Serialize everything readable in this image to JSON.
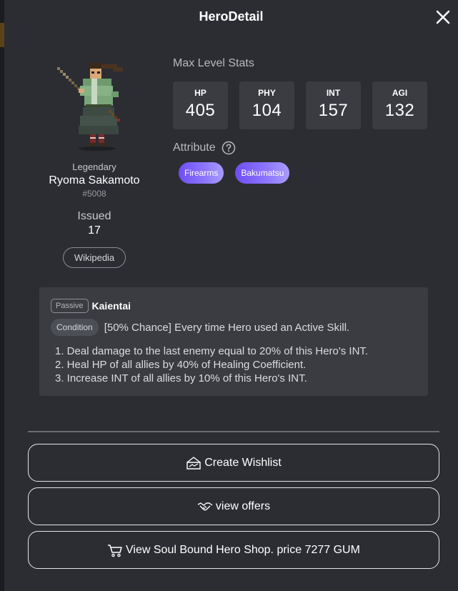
{
  "window": {
    "title": "HeroDetail",
    "close_icon": "close-icon"
  },
  "hero": {
    "rarity": "Legendary",
    "name": "Ryoma Sakamoto",
    "id": "#5008",
    "issued_label": "Issued",
    "issued_value": "17",
    "wiki_label": "Wikipedia"
  },
  "stats": {
    "heading": "Max Level Stats",
    "items": [
      {
        "name": "HP",
        "value": "405"
      },
      {
        "name": "PHY",
        "value": "104"
      },
      {
        "name": "INT",
        "value": "157"
      },
      {
        "name": "AGI",
        "value": "132"
      }
    ]
  },
  "attributes": {
    "heading": "Attribute",
    "help_icon": "question-circle-icon",
    "tags": [
      "Firearms",
      "Bakumatsu"
    ]
  },
  "skill": {
    "type_label": "Passive",
    "name": "Kaientai",
    "condition_label": "Condition",
    "condition_text": "[50% Chance] Every time Hero used an Active Skill.",
    "effects": [
      "1. Deal damage to the last enemy equal to 20% of this Hero's INT.",
      "2. Heal HP of all allies by 40% of Healing Coefficient.",
      "3. Increase INT of all allies by 10% of this Hero's INT."
    ]
  },
  "actions": {
    "wishlist": {
      "label": "Create Wishlist",
      "icon": "wishlist-sign-icon"
    },
    "offers": {
      "label": "view offers",
      "icon": "handshake-icon"
    },
    "shop": {
      "label": "View Soul Bound Hero Shop. price 7277 GUM",
      "icon": "cart-icon"
    }
  },
  "colors": {
    "modal_bg": "#2b2d33",
    "panel_bg": "#3a3c42",
    "tag_gradient_start": "#6f4df2",
    "tag_gradient_end": "#a99cff"
  }
}
